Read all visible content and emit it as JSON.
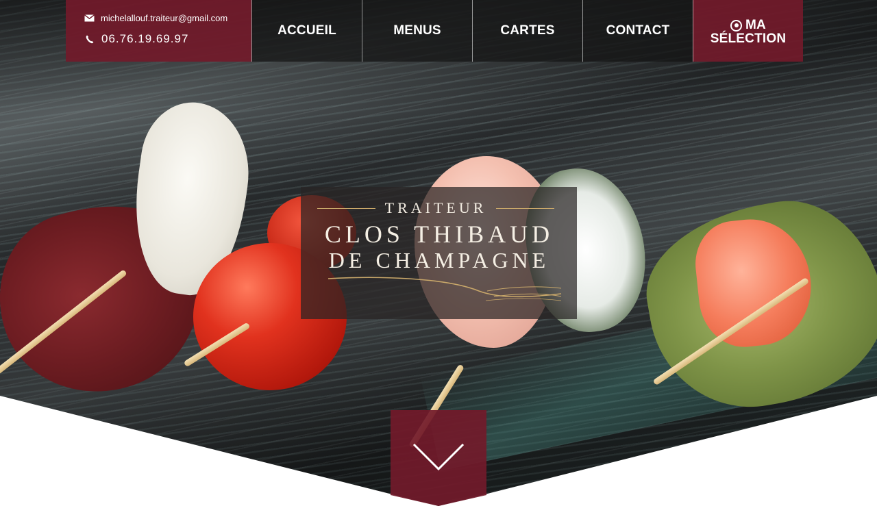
{
  "contact": {
    "email": "michelallouf.traiteur@gmail.com",
    "phone": "06.76.19.69.97",
    "email_icon": "envelope-icon",
    "phone_icon": "phone-icon"
  },
  "nav": {
    "items": [
      {
        "label": "ACCUEIL"
      },
      {
        "label": "MENUS"
      },
      {
        "label": "CARTES"
      },
      {
        "label": "CONTACT"
      }
    ],
    "selection_line1": "MA",
    "selection_line2": "SÉLECTION",
    "selection_icon": "target-circle-icon"
  },
  "logo": {
    "top": "TRAITEUR",
    "line1": "CLOS THIBAUD",
    "line2": "DE CHAMPAGNE"
  },
  "scroll": {
    "icon": "chevron-down-icon"
  },
  "colors": {
    "brand": "#721a2a",
    "nav_dark": "#141414",
    "gold": "#c9a86a"
  }
}
